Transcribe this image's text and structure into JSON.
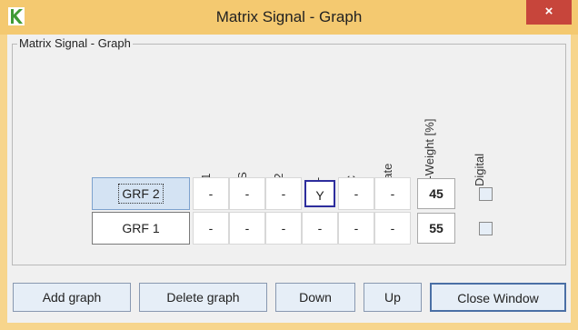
{
  "window": {
    "title": "Matrix Signal - Graph",
    "close_glyph": "×"
  },
  "group": {
    "label": "Matrix Signal - Graph"
  },
  "columns": [
    "u1",
    "uS",
    "u2",
    "iL",
    "iC",
    "gate",
    "Y-Weight [%]",
    "Digital"
  ],
  "rows": [
    {
      "name": "GRF 2",
      "cells": [
        "-",
        "-",
        "-",
        "Y",
        "-",
        "-"
      ],
      "weight": "45",
      "digital": false,
      "selected": true
    },
    {
      "name": "GRF 1",
      "cells": [
        "-",
        "-",
        "-",
        "-",
        "-",
        "-"
      ],
      "weight": "55",
      "digital": false,
      "selected": false
    }
  ],
  "buttons": {
    "add": "Add graph",
    "delete": "Delete graph",
    "down": "Down",
    "up": "Up",
    "close": "Close Window"
  },
  "colors": {
    "titlebar": "#f4c970",
    "close": "#c7453b",
    "client": "#f0f0f0",
    "button": "#e6eef7",
    "accent": "#2d2d9d"
  }
}
